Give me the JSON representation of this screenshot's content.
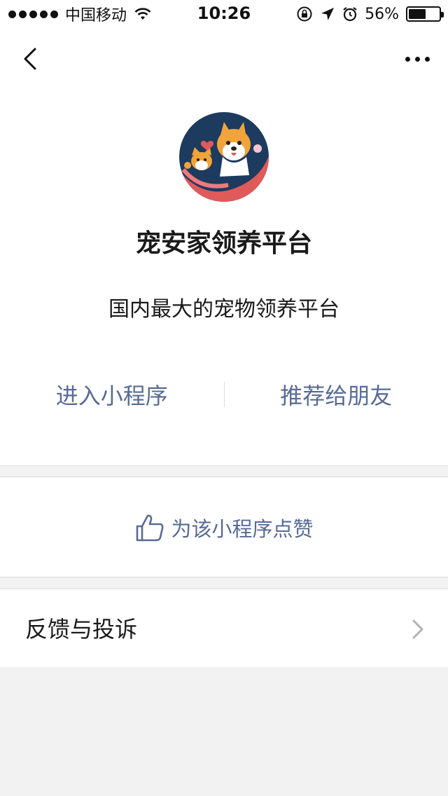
{
  "status_bar": {
    "carrier": "中国移动",
    "time": "10:26",
    "battery_percent_text": "56%",
    "battery_level": 0.56,
    "icons": [
      "signal-dots-icon",
      "wifi-icon",
      "orientation-lock-icon",
      "location-arrow-icon",
      "alarm-icon",
      "battery-icon"
    ]
  },
  "nav": {
    "back_icon": "chevron-left-icon",
    "more_icon": "more-dots-icon"
  },
  "profile": {
    "name": "宠安家领养平台",
    "description": "国内最大的宠物领养平台",
    "avatar_icon": "dog-and-cat-avatar"
  },
  "actions": {
    "enter_label": "进入小程序",
    "recommend_label": "推荐给朋友"
  },
  "like": {
    "label": "为该小程序点赞",
    "icon": "thumbs-up-icon"
  },
  "feedback": {
    "label": "反馈与投诉",
    "icon": "chevron-right-icon"
  },
  "colors": {
    "link": "#576b95",
    "background": "#f2f2f2",
    "avatar_bg": "#1d3a5f",
    "avatar_accent": "#e05a5a",
    "dog_orange": "#f0a43a"
  }
}
